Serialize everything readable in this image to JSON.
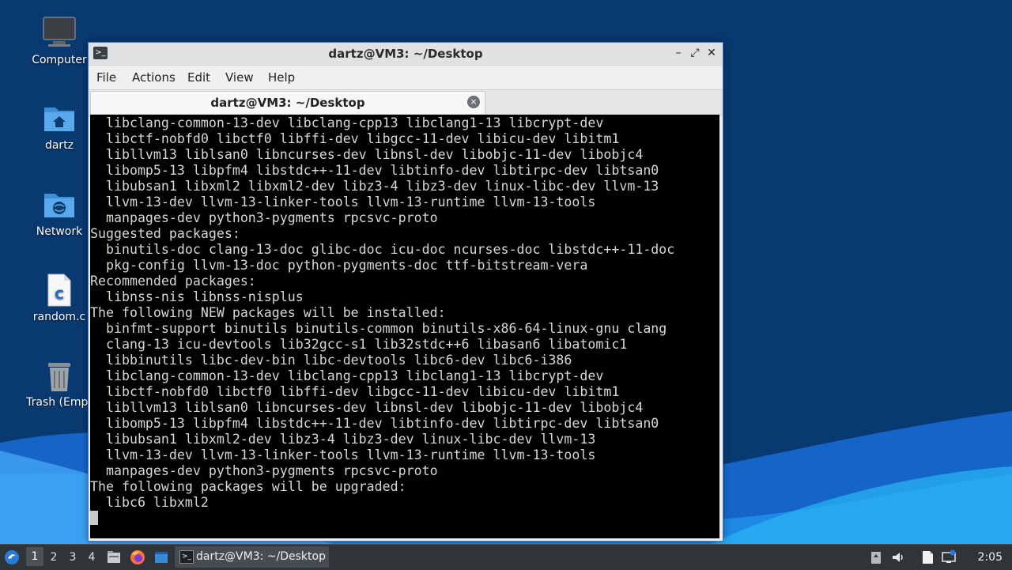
{
  "desktop": {
    "icons": [
      {
        "label": "Computer",
        "icon": "computer-icon"
      },
      {
        "label": "dartz",
        "icon": "home-folder-icon"
      },
      {
        "label": "Network",
        "icon": "network-folder-icon"
      },
      {
        "label": "random.c",
        "icon": "c-source-file-icon"
      },
      {
        "label": "Trash (Empt",
        "icon": "trash-icon"
      }
    ]
  },
  "window": {
    "title": "dartz@VM3: ~/Desktop",
    "controls": {
      "minimize": "–",
      "maximize": "⤢",
      "close": "✕"
    },
    "menu": [
      "File",
      "Actions",
      "Edit",
      "View",
      "Help"
    ],
    "tab": {
      "label": "dartz@VM3: ~/Desktop",
      "close": "×"
    }
  },
  "terminal": {
    "lines": [
      "  libclang-common-13-dev libclang-cpp13 libclang1-13 libcrypt-dev",
      "  libctf-nobfd0 libctf0 libffi-dev libgcc-11-dev libicu-dev libitm1",
      "  libllvm13 liblsan0 libncurses-dev libnsl-dev libobjc-11-dev libobjc4",
      "  libomp5-13 libpfm4 libstdc++-11-dev libtinfo-dev libtirpc-dev libtsan0",
      "  libubsan1 libxml2 libxml2-dev libz3-4 libz3-dev linux-libc-dev llvm-13",
      "  llvm-13-dev llvm-13-linker-tools llvm-13-runtime llvm-13-tools",
      "  manpages-dev python3-pygments rpcsvc-proto",
      "Suggested packages:",
      "  binutils-doc clang-13-doc glibc-doc icu-doc ncurses-doc libstdc++-11-doc",
      "  pkg-config llvm-13-doc python-pygments-doc ttf-bitstream-vera",
      "Recommended packages:",
      "  libnss-nis libnss-nisplus",
      "The following NEW packages will be installed:",
      "  binfmt-support binutils binutils-common binutils-x86-64-linux-gnu clang",
      "  clang-13 icu-devtools lib32gcc-s1 lib32stdc++6 libasan6 libatomic1",
      "  libbinutils libc-dev-bin libc-devtools libc6-dev libc6-i386",
      "  libclang-common-13-dev libclang-cpp13 libclang1-13 libcrypt-dev",
      "  libctf-nobfd0 libctf0 libffi-dev libgcc-11-dev libicu-dev libitm1",
      "  libllvm13 liblsan0 libncurses-dev libnsl-dev libobjc-11-dev libobjc4",
      "  libomp5-13 libpfm4 libstdc++-11-dev libtinfo-dev libtirpc-dev libtsan0",
      "  libubsan1 libxml2-dev libz3-4 libz3-dev linux-libc-dev llvm-13",
      "  llvm-13-dev llvm-13-linker-tools llvm-13-runtime llvm-13-tools",
      "  manpages-dev python3-pygments rpcsvc-proto",
      "The following packages will be upgraded:",
      "  libc6 libxml2"
    ]
  },
  "taskbar": {
    "workspaces": [
      "1",
      "2",
      "3",
      "4"
    ],
    "active_workspace": "1",
    "launchers": [
      "start-menu-icon",
      "file-manager-icon",
      "firefox-icon",
      "show-desktop-icon"
    ],
    "task": {
      "label": "dartz@VM3: ~/Desktop",
      "icon": "terminal-icon"
    },
    "tray": [
      "clipboard-icon",
      "volume-icon",
      "notes-icon",
      "network-icon"
    ],
    "clock": "2:05"
  },
  "colors": {
    "window_border": "#3c79c6",
    "terminal_bg": "#000000",
    "terminal_fg": "#d7d7d7",
    "taskbar_bg": "#2f3438"
  }
}
